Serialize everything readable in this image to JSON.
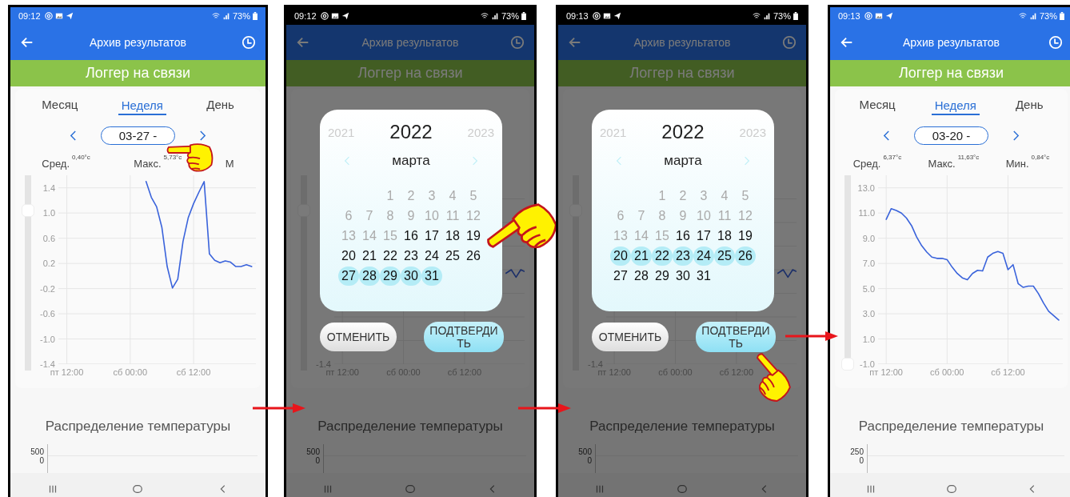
{
  "screens": [
    {
      "status_bar": {
        "time": "09:12",
        "battery": "73%"
      },
      "app_bar": {
        "title": "Архив результатов"
      },
      "banner": "Логгер на связи",
      "tabs": [
        {
          "label": "Месяц",
          "selected": false
        },
        {
          "label": "Неделя",
          "selected": true
        },
        {
          "label": "День",
          "selected": false
        }
      ],
      "date_range": "03-27 -",
      "stats": [
        {
          "label": "Сред.",
          "value": "0,40°c"
        },
        {
          "label": "Макс.",
          "value": "5,73°c"
        },
        {
          "label": "М"
        }
      ],
      "zoom_slider": {
        "level": 0.84
      },
      "chart_data": {
        "type": "line",
        "categories": [
          "пт 12:00",
          null,
          null,
          null,
          null,
          null,
          null,
          null,
          null,
          null,
          null,
          null,
          "сб 00:00",
          null,
          null,
          null,
          null,
          null,
          null,
          null,
          null,
          null,
          null,
          null,
          "сб 12:00",
          null,
          null,
          null,
          null,
          null,
          null,
          null,
          null,
          null,
          null,
          null
        ],
        "series": [
          {
            "color": "#3a63db",
            "values": [
              null,
              null,
              null,
              null,
              null,
              null,
              null,
              null,
              null,
              null,
              null,
              null,
              null,
              null,
              null,
              1.5,
              1.25,
              1.1,
              0.77,
              0.15,
              -0.19,
              -0.05,
              0.55,
              0.93,
              1.15,
              1.33,
              1.5,
              0.35,
              0.25,
              0.21,
              0.24,
              0.22,
              0.15,
              0.15,
              0.18,
              0.15
            ]
          }
        ],
        "grid": true,
        "ylim": [
          -1.4,
          1.6
        ],
        "yticks": [
          {
            "value": 1.4,
            "label": "1.4"
          },
          {
            "value": 1,
            "label": "1.0"
          },
          {
            "value": 0.6,
            "label": "0.6"
          },
          {
            "value": 0.2,
            "label": "0.2"
          },
          {
            "value": -0.2,
            "label": "-0.2"
          },
          {
            "value": -0.6,
            "label": "-0.6"
          },
          {
            "value": -1,
            "label": "-1.0"
          },
          {
            "value": -1.4,
            "label": "-1.4"
          }
        ]
      },
      "distribution": {
        "title": "Распределение температуры",
        "y_labels": [
          "500",
          "0"
        ]
      },
      "pointer": {
        "kind": "date_range"
      }
    },
    {
      "status_bar": {
        "time": "09:12",
        "battery": "73%"
      },
      "app_bar": {
        "title": "Архив результатов"
      },
      "banner": "Логгер на связи",
      "zoom_slider": {
        "level": 0.84
      },
      "chart_backdrop": {
        "x_labels": [
          "пт 12:00",
          "сб 00:00",
          "сб 12:00"
        ],
        "y_label": "-1.4"
      },
      "distribution": {
        "title": "Распределение температуры",
        "y_labels": [
          "500",
          "0"
        ]
      },
      "dialog": {
        "years": [
          {
            "label": "2021",
            "selected": false
          },
          {
            "label": "2022",
            "selected": true
          },
          {
            "label": "2023",
            "selected": false
          }
        ],
        "month": "марта",
        "days": [
          {
            "label": "1",
            "disabled": true,
            "selected": false
          },
          {
            "label": "2",
            "disabled": true,
            "selected": false
          },
          {
            "label": "3",
            "disabled": true,
            "selected": false
          },
          {
            "label": "4",
            "disabled": true,
            "selected": false
          },
          {
            "label": "5",
            "disabled": true,
            "selected": false
          },
          {
            "label": "6",
            "disabled": true,
            "selected": false
          },
          {
            "label": "7",
            "disabled": true,
            "selected": false
          },
          {
            "label": "8",
            "disabled": true,
            "selected": false
          },
          {
            "label": "9",
            "disabled": true,
            "selected": false
          },
          {
            "label": "10",
            "disabled": true,
            "selected": false
          },
          {
            "label": "11",
            "disabled": true,
            "selected": false
          },
          {
            "label": "12",
            "disabled": true,
            "selected": false
          },
          {
            "label": "13",
            "disabled": true,
            "selected": false
          },
          {
            "label": "14",
            "disabled": true,
            "selected": false
          },
          {
            "label": "15",
            "disabled": true,
            "selected": false
          },
          {
            "label": "16",
            "disabled": false,
            "selected": false
          },
          {
            "label": "17",
            "disabled": false,
            "selected": false
          },
          {
            "label": "18",
            "disabled": false,
            "selected": false
          },
          {
            "label": "19",
            "disabled": false,
            "selected": false
          },
          {
            "label": "20",
            "disabled": false,
            "selected": false
          },
          {
            "label": "21",
            "disabled": false,
            "selected": false
          },
          {
            "label": "22",
            "disabled": false,
            "selected": false
          },
          {
            "label": "23",
            "disabled": false,
            "selected": false
          },
          {
            "label": "24",
            "disabled": false,
            "selected": false
          },
          {
            "label": "25",
            "disabled": false,
            "selected": false
          },
          {
            "label": "26",
            "disabled": false,
            "selected": false
          },
          {
            "label": "27",
            "disabled": false,
            "selected": true
          },
          {
            "label": "28",
            "disabled": false,
            "selected": true
          },
          {
            "label": "29",
            "disabled": false,
            "selected": true
          },
          {
            "label": "30",
            "disabled": false,
            "selected": true
          },
          {
            "label": "31",
            "disabled": false,
            "selected": true
          }
        ],
        "cancel": "ОТМЕНИТЬ",
        "confirm": "ПОДТВЕРДИТЬ"
      },
      "pointer": {
        "kind": "day"
      }
    },
    {
      "status_bar": {
        "time": "09:13",
        "battery": "73%"
      },
      "app_bar": {
        "title": "Архив результатов"
      },
      "banner": "Логгер на связи",
      "zoom_slider": {
        "level": 0.84
      },
      "chart_backdrop": {
        "x_labels": [
          "пт 12:00",
          "сб 00:00",
          "сб 12:00"
        ],
        "y_label": "-1.4"
      },
      "distribution": {
        "title": "Распределение температуры",
        "y_labels": [
          "500",
          "0"
        ]
      },
      "dialog": {
        "years": [
          {
            "label": "2021",
            "selected": false
          },
          {
            "label": "2022",
            "selected": true
          },
          {
            "label": "2023",
            "selected": false
          }
        ],
        "month": "марта",
        "days": [
          {
            "label": "1",
            "disabled": true,
            "selected": false
          },
          {
            "label": "2",
            "disabled": true,
            "selected": false
          },
          {
            "label": "3",
            "disabled": true,
            "selected": false
          },
          {
            "label": "4",
            "disabled": true,
            "selected": false
          },
          {
            "label": "5",
            "disabled": true,
            "selected": false
          },
          {
            "label": "6",
            "disabled": true,
            "selected": false
          },
          {
            "label": "7",
            "disabled": true,
            "selected": false
          },
          {
            "label": "8",
            "disabled": true,
            "selected": false
          },
          {
            "label": "9",
            "disabled": true,
            "selected": false
          },
          {
            "label": "10",
            "disabled": true,
            "selected": false
          },
          {
            "label": "11",
            "disabled": true,
            "selected": false
          },
          {
            "label": "12",
            "disabled": true,
            "selected": false
          },
          {
            "label": "13",
            "disabled": true,
            "selected": false
          },
          {
            "label": "14",
            "disabled": true,
            "selected": false
          },
          {
            "label": "15",
            "disabled": true,
            "selected": false
          },
          {
            "label": "16",
            "disabled": false,
            "selected": false
          },
          {
            "label": "17",
            "disabled": false,
            "selected": false
          },
          {
            "label": "18",
            "disabled": false,
            "selected": false
          },
          {
            "label": "19",
            "disabled": false,
            "selected": false
          },
          {
            "label": "20",
            "disabled": false,
            "selected": true
          },
          {
            "label": "21",
            "disabled": false,
            "selected": true
          },
          {
            "label": "22",
            "disabled": false,
            "selected": true
          },
          {
            "label": "23",
            "disabled": false,
            "selected": true
          },
          {
            "label": "24",
            "disabled": false,
            "selected": true
          },
          {
            "label": "25",
            "disabled": false,
            "selected": true
          },
          {
            "label": "26",
            "disabled": false,
            "selected": true
          },
          {
            "label": "27",
            "disabled": false,
            "selected": false
          },
          {
            "label": "28",
            "disabled": false,
            "selected": false
          },
          {
            "label": "29",
            "disabled": false,
            "selected": false
          },
          {
            "label": "30",
            "disabled": false,
            "selected": false
          },
          {
            "label": "31",
            "disabled": false,
            "selected": false
          }
        ],
        "cancel": "ОТМЕНИТЬ",
        "confirm": "ПОДТВЕРДИТЬ"
      },
      "pointer": {
        "kind": "confirm"
      }
    },
    {
      "status_bar": {
        "time": "09:13",
        "battery": "73%"
      },
      "app_bar": {
        "title": "Архив результатов"
      },
      "banner": "Логгер на связи",
      "tabs": [
        {
          "label": "Месяц",
          "selected": false
        },
        {
          "label": "Неделя",
          "selected": true
        },
        {
          "label": "День",
          "selected": false
        }
      ],
      "date_range": "03-20 -",
      "stats": [
        {
          "label": "Сред.",
          "value": "6,37°c"
        },
        {
          "label": "Макс.",
          "value": "11,63°c"
        },
        {
          "label": "Мин.",
          "value": "0,84°c"
        }
      ],
      "zoom_slider": {
        "level": 0
      },
      "chart_data": {
        "type": "line",
        "categories": [
          "пт 12:00",
          null,
          null,
          null,
          null,
          null,
          null,
          null,
          null,
          null,
          null,
          null,
          "сб 00:00",
          null,
          null,
          null,
          null,
          null,
          null,
          null,
          null,
          null,
          null,
          null,
          "сб 12:00",
          null,
          null,
          null,
          null,
          null,
          null,
          null,
          null,
          null,
          null
        ],
        "series": [
          {
            "color": "#3a63db",
            "values": [
              10.5,
              11.35,
              11.2,
              11.0,
              10.6,
              10.0,
              9.1,
              8.4,
              7.9,
              7.5,
              7.4,
              7.4,
              7.3,
              6.7,
              6.2,
              5.85,
              5.7,
              6.2,
              6.45,
              6.4,
              7.5,
              7.8,
              7.95,
              7.8,
              6.5,
              6.9,
              5.4,
              5.1,
              5.2,
              5.2,
              4.6,
              3.85,
              3.2,
              2.85,
              2.5
            ]
          }
        ],
        "grid": true,
        "ylim": [
          -1,
          14
        ],
        "yticks": [
          {
            "value": 13,
            "label": "13.0"
          },
          {
            "value": 11,
            "label": "11.0"
          },
          {
            "value": 9,
            "label": "9.0"
          },
          {
            "value": 7,
            "label": "7.0"
          },
          {
            "value": 5,
            "label": "5.0"
          },
          {
            "value": 3,
            "label": "3.0"
          },
          {
            "value": 1,
            "label": "1.0"
          },
          {
            "value": -1,
            "label": "-1.0"
          }
        ]
      },
      "distribution": {
        "title": "Распределение температуры",
        "y_labels": [
          "250",
          "0"
        ]
      }
    }
  ]
}
